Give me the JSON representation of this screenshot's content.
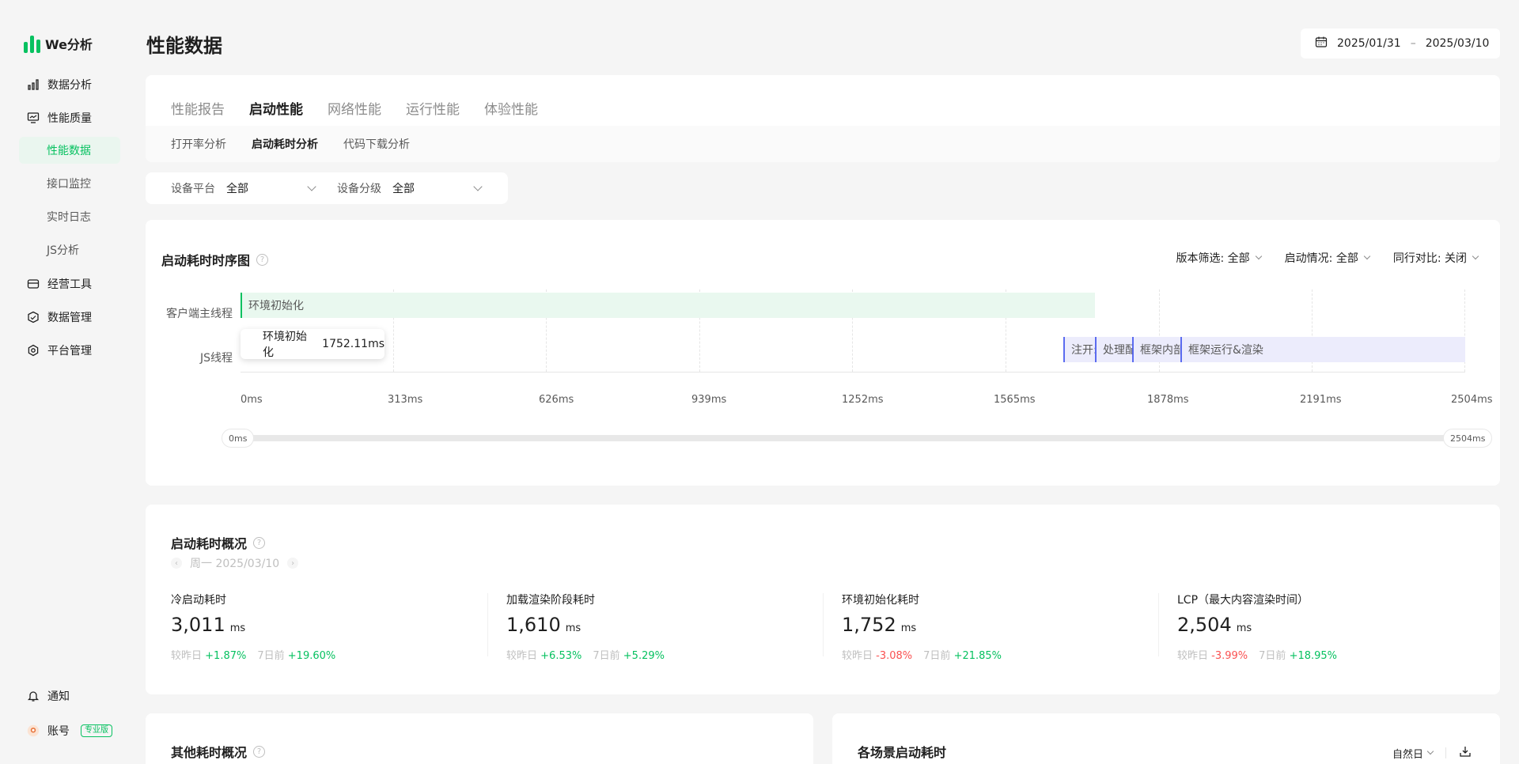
{
  "app": {
    "name": "We分析"
  },
  "sidebar": {
    "items": [
      {
        "label": "数据分析",
        "icon": "bar-chart-icon"
      },
      {
        "label": "性能质量",
        "icon": "monitor-icon"
      },
      {
        "label": "经营工具",
        "icon": "wallet-icon"
      },
      {
        "label": "数据管理",
        "icon": "database-icon"
      },
      {
        "label": "平台管理",
        "icon": "settings-icon"
      }
    ],
    "subitems": [
      "性能数据",
      "接口监控",
      "实时日志",
      "JS分析"
    ],
    "active_sub": "性能数据",
    "notify": "通知",
    "account": "账号",
    "account_badge": "专业版"
  },
  "header": {
    "title": "性能数据",
    "date_start": "2025/01/31",
    "date_sep": "–",
    "date_end": "2025/03/10"
  },
  "tabs": [
    "性能报告",
    "启动性能",
    "网络性能",
    "运行性能",
    "体验性能"
  ],
  "active_tab": "启动性能",
  "subtabs": [
    "打开率分析",
    "启动耗时分析",
    "代码下载分析"
  ],
  "active_subtab": "启动耗时分析",
  "filters": {
    "platform_label": "设备平台",
    "platform_value": "全部",
    "level_label": "设备分级",
    "level_value": "全部"
  },
  "timeline": {
    "title": "启动耗时时序图",
    "filter_version": "版本筛选: 全部",
    "filter_launch": "启动情况: 全部",
    "filter_peer": "同行对比: 关闭",
    "lanes": [
      "客户端主线程",
      "JS线程"
    ],
    "segments": {
      "main_env": "环境初始化",
      "js_1": "注开:",
      "js_2": "处理配",
      "js_3": "框架内部",
      "js_4": "框架运行&渲染"
    },
    "tooltip_label": "环境初始化",
    "tooltip_value": "1752.11ms",
    "ticks": [
      "0ms",
      "313ms",
      "626ms",
      "939ms",
      "1252ms",
      "1565ms",
      "1878ms",
      "2191ms",
      "2504ms"
    ],
    "slider_start": "0ms",
    "slider_end": "2504ms"
  },
  "overview": {
    "title": "启动耗时概况",
    "date": "周一 2025/03/10",
    "metrics": [
      {
        "name": "冷启动耗时",
        "value": "3,011",
        "unit": "ms",
        "d_label": "较昨日",
        "d_value": "+1.87%",
        "w_label": "7日前",
        "w_value": "+19.60%"
      },
      {
        "name": "加载渲染阶段耗时",
        "value": "1,610",
        "unit": "ms",
        "d_label": "较昨日",
        "d_value": "+6.53%",
        "w_label": "7日前",
        "w_value": "+5.29%"
      },
      {
        "name": "环境初始化耗时",
        "value": "1,752",
        "unit": "ms",
        "d_label": "较昨日",
        "d_value": "-3.08%",
        "w_label": "7日前",
        "w_value": "+21.85%"
      },
      {
        "name": "LCP（最大内容渲染时间）",
        "value": "2,504",
        "unit": "ms",
        "d_label": "较昨日",
        "d_value": "-3.99%",
        "w_label": "7日前",
        "w_value": "+18.95%"
      }
    ]
  },
  "bottom": {
    "left_title": "其他耗时概况",
    "right_title": "各场景启动耗时",
    "right_filter": "自然日"
  },
  "colors": {
    "accent": "#07c160",
    "down": "#fa5151",
    "js_lane": "#5b6bf0"
  }
}
